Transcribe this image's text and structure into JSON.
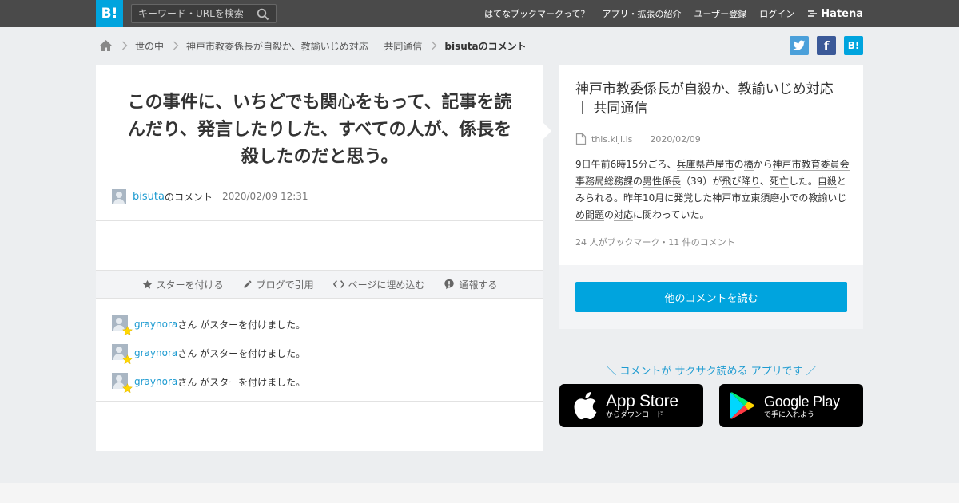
{
  "header": {
    "logo": "B!",
    "search_placeholder": "キーワード・URLを検索",
    "nav": [
      "はてなブックマークって？",
      "アプリ・拡張の紹介",
      "ユーザー登録",
      "ログイン"
    ],
    "brand": "Hatena"
  },
  "breadcrumb": {
    "items": [
      "世の中",
      "神戸市教委係長が自殺か、教諭いじめ対応 ｜ 共同通信",
      "bisutaのコメント"
    ]
  },
  "share": {
    "twitter": "t",
    "facebook": "f",
    "hatena": "B!"
  },
  "comment": {
    "text": "この事件に、いちどでも関心をもって、記事を読んだり、発言したりした、すべての人が、係長を殺したのだと思う。",
    "user": "bisuta",
    "user_suffix": "のコメント",
    "date": "2020/02/09 12:31"
  },
  "actions": [
    "スターを付ける",
    "ブログで引用",
    "ページに埋め込む",
    "通報する"
  ],
  "stars": [
    {
      "user": "graynora",
      "text": "さん がスターを付けました。"
    },
    {
      "user": "graynora",
      "text": "さん がスターを付けました。"
    },
    {
      "user": "graynora",
      "text": "さん がスターを付けました。"
    }
  ],
  "entry": {
    "title": "神戸市教委係長が自殺か、教諭いじめ対応 ｜ 共同通信",
    "site": "this.kiji.is",
    "date": "2020/02/09",
    "summary": {
      "s1": "9日午前6時15分ごろ、",
      "k1": "兵庫県芦屋市",
      "s2": "の",
      "k2": "橋",
      "s3": "から",
      "k3": "神戸市教育委員会事務局総務課",
      "s4": "の",
      "k4": "男性係長",
      "s5": "（39）が",
      "k5": "飛び降り",
      "s6": "、",
      "k6": "死亡",
      "s7": "した。",
      "k7": "自殺",
      "s8": "とみられる。昨年",
      "k8": "10月",
      "s9": "に発覚した",
      "k9": "神戸市立東須磨小",
      "s10": "での",
      "k10": "教諭いじめ問題",
      "s11": "の",
      "k11": "対応",
      "s12": "に関わっていた。"
    },
    "counts": "24 人がブックマーク・11 件のコメント"
  },
  "read_button": "他のコメントを読む",
  "promo": "＼ コメントが サクサク読める アプリです ／",
  "stores": {
    "apple": {
      "big": "App Store",
      "small": "からダウンロード"
    },
    "google": {
      "big": "Google Play",
      "small": "で手に入れよう"
    }
  },
  "colors": {
    "accent": "#00a4de",
    "header_bg": "#4a4a4a",
    "link": "#1d9bd1"
  }
}
